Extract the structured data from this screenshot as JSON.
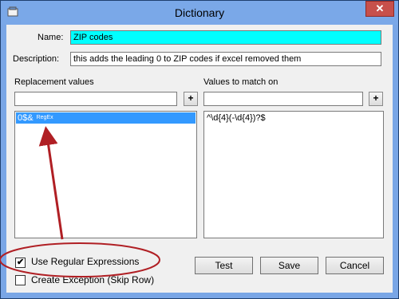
{
  "window": {
    "title": "Dictionary",
    "close_symbol": "✕"
  },
  "form": {
    "name_label": "Name:",
    "name_value": "ZIP codes",
    "description_label": "Description:",
    "description_value": "this adds the leading 0 to ZIP codes if excel removed them"
  },
  "replacement": {
    "header": "Replacement values",
    "input_value": "",
    "add_label": "+",
    "items": [
      {
        "value": "0$&",
        "tag": "RegEx"
      }
    ]
  },
  "match": {
    "header": "Values to match on",
    "input_value": "",
    "add_label": "+",
    "text": "^\\d{4}(-\\d{4})?$"
  },
  "options": {
    "use_regex_label": "Use Regular Expressions",
    "use_regex_checked": true,
    "check_mark": "✔",
    "create_exception_label": "Create Exception (Skip Row)",
    "create_exception_checked": false
  },
  "buttons": {
    "test": "Test",
    "save": "Save",
    "cancel": "Cancel"
  },
  "annotation": {
    "color": "#b01f24"
  },
  "colors": {
    "titlebar": "#7aa8e8",
    "selection": "#3399ff",
    "name_highlight": "#00ffff"
  }
}
